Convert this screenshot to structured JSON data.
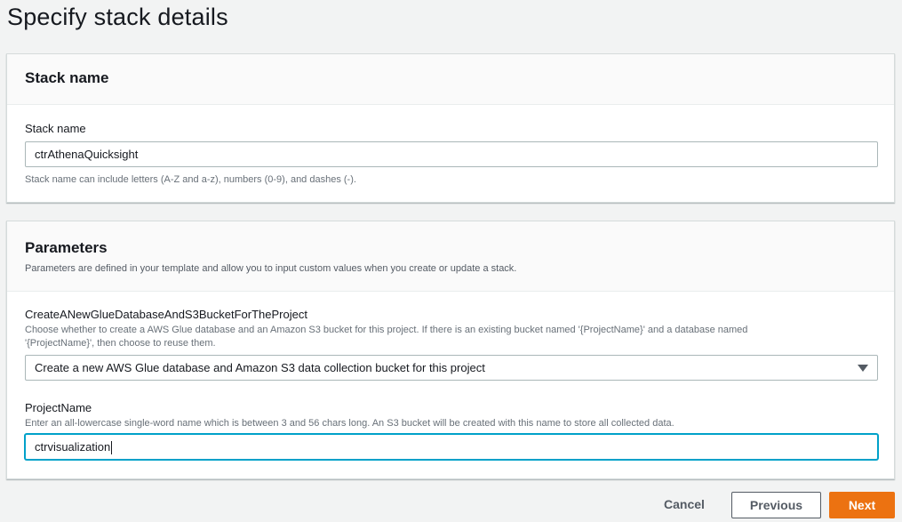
{
  "page": {
    "title": "Specify stack details"
  },
  "stack_panel": {
    "header": "Stack name",
    "field_label": "Stack name",
    "field_value": "ctrAthenaQuicksight",
    "field_hint": "Stack name can include letters (A-Z and a-z), numbers (0-9), and dashes (-)."
  },
  "parameters_panel": {
    "header": "Parameters",
    "description": "Parameters are defined in your template and allow you to input custom values when you create or update a stack.",
    "create_param": {
      "label": "CreateANewGlueDatabaseAndS3BucketForTheProject",
      "desc_line1": "Choose whether to create a AWS Glue database and an Amazon S3 bucket for this project. If there is an existing bucket named '{ProjectName}' and a database named",
      "desc_line2": "'{ProjectName}', then choose to reuse them.",
      "selected": "Create a new AWS Glue database and Amazon S3 data collection bucket for this project"
    },
    "project_param": {
      "label": "ProjectName",
      "description": "Enter an all-lowercase single-word name which is between 3 and 56 chars long. An S3 bucket will be created with this name to store all collected data.",
      "value": "ctrvisualization"
    }
  },
  "footer": {
    "cancel": "Cancel",
    "previous": "Previous",
    "next": "Next"
  },
  "colors": {
    "primary_button": "#ec7211",
    "focus_border": "#00a1c9",
    "background": "#f2f3f3"
  }
}
